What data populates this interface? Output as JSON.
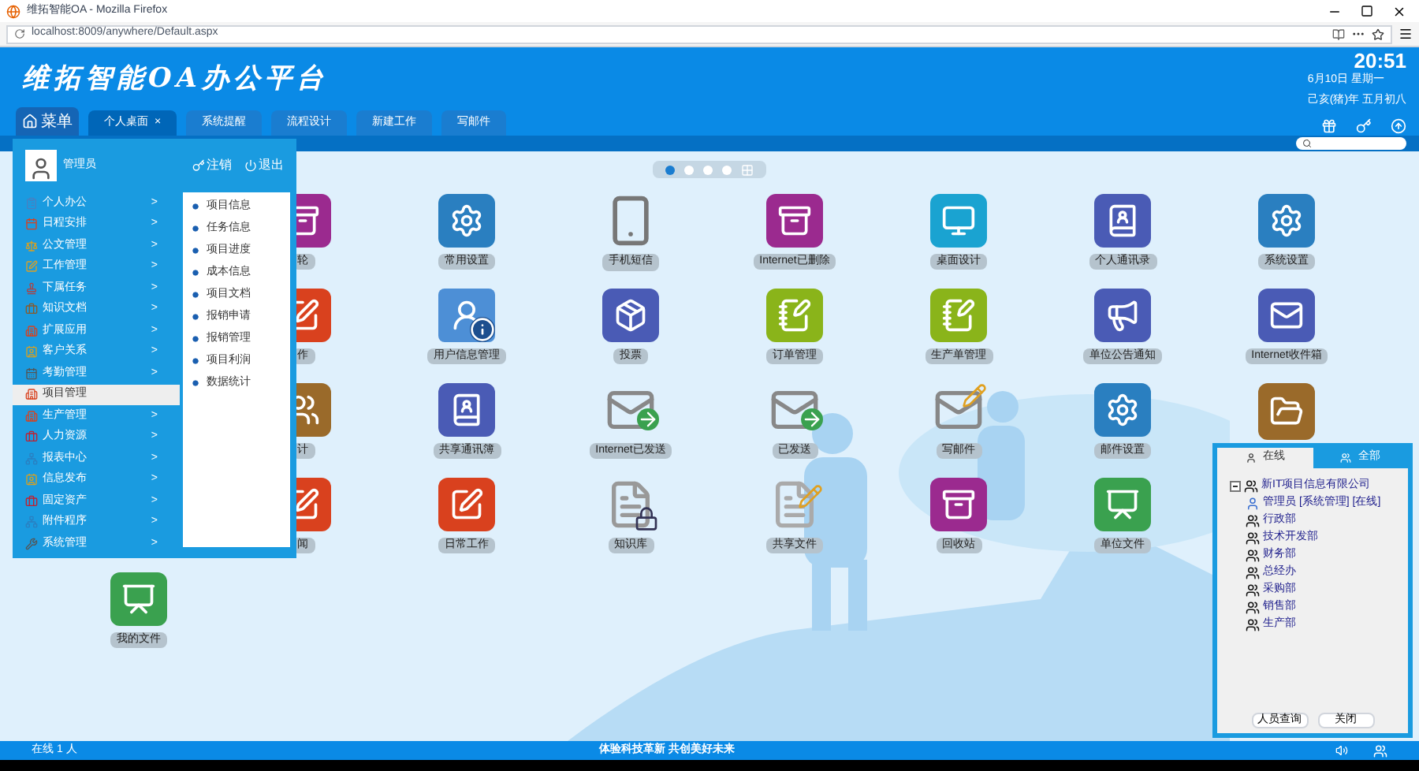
{
  "browser": {
    "title": "维拓智能OA - Mozilla Firefox",
    "url": "localhost:8009/anywhere/Default.aspx"
  },
  "header": {
    "logo": "维拓智能OA办公平台",
    "time": "20:51",
    "date": "6月10日 星期一",
    "lunar": "己亥(猪)年 五月初八",
    "menu_button": "菜单"
  },
  "tabs": [
    {
      "label": "个人桌面",
      "selected": true,
      "close": "×"
    },
    {
      "label": "系统提醒",
      "selected": false
    },
    {
      "label": "流程设计",
      "selected": false
    },
    {
      "label": "新建工作",
      "selected": false
    },
    {
      "label": "写邮件",
      "selected": false
    }
  ],
  "menu": {
    "user": "管理员",
    "logout": "注销",
    "exit": "退出",
    "items": [
      {
        "label": "个人办公",
        "selected": false,
        "arrow": ">"
      },
      {
        "label": "日程安排",
        "selected": false,
        "arrow": ">"
      },
      {
        "label": "公文管理",
        "selected": false,
        "arrow": ">"
      },
      {
        "label": "工作管理",
        "selected": false,
        "arrow": ">"
      },
      {
        "label": "下属任务",
        "selected": false,
        "arrow": ">"
      },
      {
        "label": "知识文档",
        "selected": false,
        "arrow": ">"
      },
      {
        "label": "扩展应用",
        "selected": false,
        "arrow": ">"
      },
      {
        "label": "客户关系",
        "selected": false,
        "arrow": ">"
      },
      {
        "label": "考勤管理",
        "selected": false,
        "arrow": ">"
      },
      {
        "label": "项目管理",
        "selected": true
      },
      {
        "label": "生产管理",
        "selected": false,
        "arrow": ">"
      },
      {
        "label": "人力资源",
        "selected": false,
        "arrow": ">"
      },
      {
        "label": "报表中心",
        "selected": false,
        "arrow": ">"
      },
      {
        "label": "信息发布",
        "selected": false,
        "arrow": ">"
      },
      {
        "label": "固定资产",
        "selected": false,
        "arrow": ">"
      },
      {
        "label": "附件程序",
        "selected": false,
        "arrow": ">"
      },
      {
        "label": "系统管理",
        "selected": false,
        "arrow": ">"
      }
    ],
    "submenu": [
      "项目信息",
      "任务信息",
      "项目进度",
      "成本信息",
      "项目文档",
      "报销申请",
      "报销管理",
      "项目利润",
      "数据统计"
    ]
  },
  "pager": [
    {
      "selected": true
    },
    {
      "selected": false
    },
    {
      "selected": false
    },
    {
      "selected": false
    }
  ],
  "desktop": [
    [
      {
        "kind": "app",
        "label": "轮"
      },
      {
        "kind": "app",
        "label": "常用设置"
      },
      {
        "kind": "app",
        "label": "手机短信"
      },
      {
        "kind": "app",
        "label": "Internet已删除"
      },
      {
        "kind": "app",
        "label": "桌面设计"
      },
      {
        "kind": "app",
        "label": "个人通讯录"
      },
      {
        "kind": "app",
        "label": "系统设置"
      }
    ],
    [
      {
        "kind": "app",
        "label": "作"
      },
      {
        "kind": "app",
        "label": "用户信息管理"
      },
      {
        "kind": "app",
        "label": "投票"
      },
      {
        "kind": "app",
        "label": "订单管理"
      },
      {
        "kind": "app",
        "label": "生产单管理"
      },
      {
        "kind": "app",
        "label": "单位公告通知"
      },
      {
        "kind": "app",
        "label": "Internet收件箱"
      }
    ],
    [
      {
        "kind": "app",
        "label": "计"
      },
      {
        "kind": "app",
        "label": "共享通讯簿"
      },
      {
        "kind": "app",
        "label": "Internet已发送"
      },
      {
        "kind": "app",
        "label": "已发送"
      },
      {
        "kind": "app",
        "label": "写邮件"
      },
      {
        "kind": "app",
        "label": "邮件设置"
      },
      {
        "kind": "app"
      }
    ],
    [
      {
        "kind": "app",
        "label": "闻"
      },
      {
        "kind": "app",
        "label": "日常工作"
      },
      {
        "kind": "app",
        "label": "知识库"
      },
      {
        "kind": "app",
        "label": "共享文件"
      },
      {
        "kind": "app",
        "label": "回收站"
      },
      {
        "kind": "app",
        "label": "单位文件"
      }
    ],
    [
      {
        "kind": "app",
        "label": "我的文件"
      }
    ]
  ],
  "online_panel": {
    "tabs": [
      {
        "label": "在线",
        "selected": true
      },
      {
        "label": "全部",
        "selected": false
      }
    ],
    "tree": [
      {
        "label": "新IT项目信息有限公司",
        "expanded": true,
        "children": [
          {
            "label": "管理员 [系统管理] [在线]",
            "kind": "user"
          },
          {
            "label": "行政部"
          },
          {
            "label": "技术开发部"
          },
          {
            "label": "财务部"
          },
          {
            "label": "总经办"
          },
          {
            "label": "采购部"
          },
          {
            "label": "销售部"
          },
          {
            "label": "生产部"
          }
        ]
      }
    ],
    "buttons": [
      "人员查询",
      "关闭"
    ]
  },
  "status_bar": {
    "online": "在线 1 人",
    "slogan": "体验科技革新 共创美好未来"
  }
}
